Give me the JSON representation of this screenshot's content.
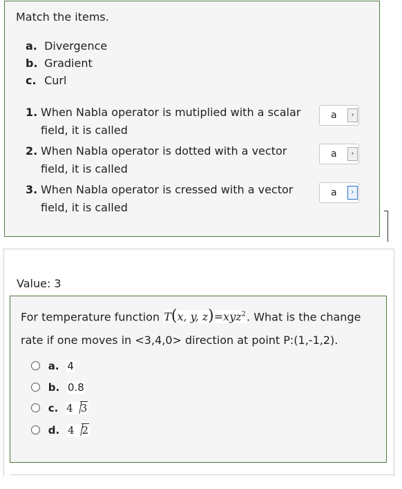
{
  "matching": {
    "instruction": "Match the items.",
    "options": [
      {
        "letter": "a.",
        "text": "Divergence"
      },
      {
        "letter": "b.",
        "text": "Gradient"
      },
      {
        "letter": "c.",
        "text": "Curl"
      }
    ],
    "questions": [
      {
        "number": "1.",
        "text": "When Nabla operator is mutiplied with a scalar field, it is called",
        "selected": "a"
      },
      {
        "number": "2.",
        "text": "When Nabla operator is dotted with a vector field, it is called",
        "selected": "a"
      },
      {
        "number": "3.",
        "text": "When Nabla operator is cressed with a vector field, it is called",
        "selected": "a"
      }
    ],
    "arrow_glyph": "›"
  },
  "mcq": {
    "value_label": "Value: 3",
    "stem_before": "For temperature function ",
    "formula": {
      "T": "T",
      "args": "x, y, z",
      "rhs": "=xyz",
      "exp": "2"
    },
    "stem_after": ". What is the change rate if one moves in <3,4,0> direction at point P:(1,-1,2).",
    "answers": [
      {
        "letter": "a.",
        "value": "4"
      },
      {
        "letter": "b.",
        "value": "0.8"
      },
      {
        "letter": "c.",
        "coef": "4",
        "radicand": "3"
      },
      {
        "letter": "d.",
        "coef": "4",
        "radicand": "2"
      }
    ]
  },
  "colors": {
    "panel_border": "#4e7a3c",
    "panel_bg": "#f5f5f5",
    "focus_blue": "#2b6ec9"
  }
}
